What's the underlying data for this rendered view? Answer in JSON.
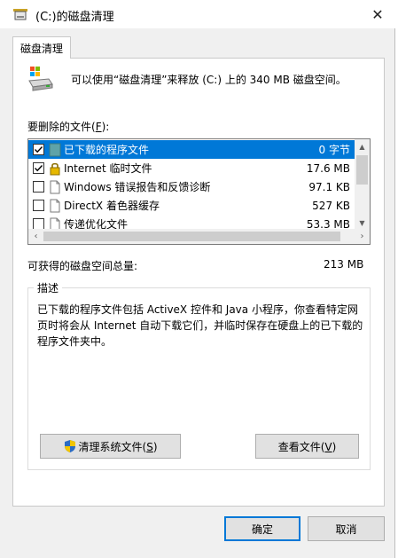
{
  "window": {
    "title": "(C:)的磁盘清理",
    "close_glyph": "✕"
  },
  "tab": {
    "label": "磁盘清理"
  },
  "intro": "可以使用“磁盘清理”来释放 (C:) 上的 340 MB 磁盘空间。",
  "files": {
    "label_prefix": "要删除的文件(",
    "label_key": "F",
    "label_suffix": "):",
    "items": [
      {
        "name": "已下载的程序文件",
        "size": "0 字节",
        "checked": true,
        "selected": true,
        "icon": "folder-icon"
      },
      {
        "name": "Internet 临时文件",
        "size": "17.6 MB",
        "checked": true,
        "selected": false,
        "icon": "lock-icon"
      },
      {
        "name": "Windows 错误报告和反馈诊断",
        "size": "97.1 KB",
        "checked": false,
        "selected": false,
        "icon": "file-icon"
      },
      {
        "name": "DirectX 着色器缓存",
        "size": "527 KB",
        "checked": false,
        "selected": false,
        "icon": "file-icon"
      },
      {
        "name": "传递优化文件",
        "size": "53.3 MB",
        "checked": false,
        "selected": false,
        "icon": "file-icon"
      }
    ]
  },
  "total": {
    "label": "可获得的磁盘空间总量:",
    "value": "213 MB"
  },
  "description": {
    "title": "描述",
    "text": "已下载的程序文件包括 ActiveX 控件和 Java 小程序，你查看特定网页时将会从 Internet 自动下载它们，并临时保存在硬盘上的已下载的程序文件夹中。"
  },
  "buttons": {
    "cleanup_system": {
      "prefix": "清理系统文件(",
      "key": "S",
      "suffix": ")"
    },
    "view_files": {
      "prefix": "查看文件(",
      "key": "V",
      "suffix": ")"
    },
    "ok": "确定",
    "cancel": "取消"
  },
  "colors": {
    "selection": "#0078d7",
    "window_bg": "#f0f0f0",
    "panel_bg": "#ffffff"
  }
}
